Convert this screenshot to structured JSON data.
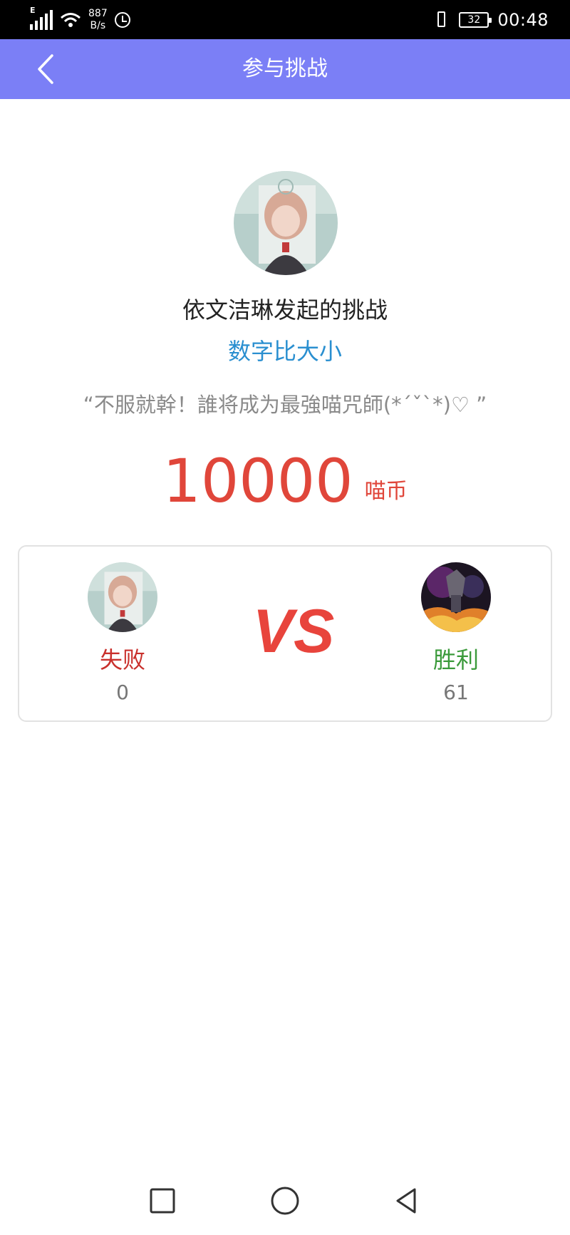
{
  "status_bar": {
    "network_type": "E",
    "speed_value": "887",
    "speed_unit": "B/s",
    "battery_level": "32",
    "time": "00:48"
  },
  "header": {
    "title": "参与挑战",
    "back_icon": "chevron-left-icon",
    "background_color": "#7b7ff6"
  },
  "challenge": {
    "challenger_text": "依文洁琳发起的挑战",
    "game_name": "数字比大小",
    "slogan": "“不服就幹！誰将成为最強喵咒師(*ˊˇˋ*)♡ ”",
    "stake_amount": "10000",
    "stake_unit": "喵币"
  },
  "match": {
    "vs_label": "VS",
    "left_player": {
      "result": "失败",
      "score": "0"
    },
    "right_player": {
      "result": "胜利",
      "score": "61"
    }
  },
  "navbar": {
    "icons": [
      "square-icon",
      "circle-home-icon",
      "triangle-back-icon"
    ]
  }
}
